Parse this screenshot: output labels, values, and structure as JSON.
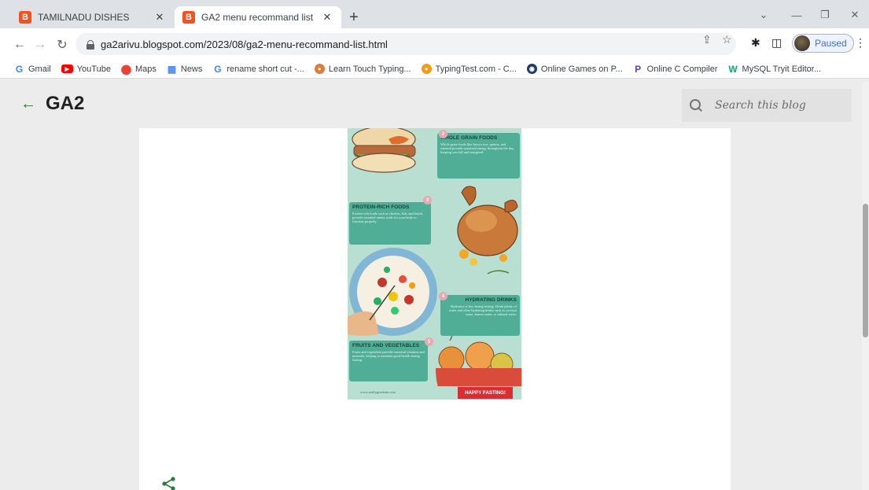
{
  "browser": {
    "tabs": [
      {
        "title": "TAMILNADU DISHES",
        "favicon": "blogger-icon",
        "active": false
      },
      {
        "title": "GA2 menu recommand list",
        "favicon": "blogger-icon",
        "active": true
      }
    ],
    "url": "ga2arivu.blogspot.com/2023/08/ga2-menu-recommand-list.html",
    "profile_status": "Paused",
    "bookmarks": [
      {
        "label": "Gmail",
        "icon": "google-icon"
      },
      {
        "label": "YouTube",
        "icon": "youtube-icon"
      },
      {
        "label": "Maps",
        "icon": "maps-icon"
      },
      {
        "label": "News",
        "icon": "news-icon"
      },
      {
        "label": "rename short cut -...",
        "icon": "google-icon"
      },
      {
        "label": "Learn Touch Typing...",
        "icon": "typing-club-icon"
      },
      {
        "label": "TypingTest.com - C...",
        "icon": "typingtest-icon"
      },
      {
        "label": "Online Games on P...",
        "icon": "poki-icon"
      },
      {
        "label": "Online C Compiler",
        "icon": "programiz-icon"
      },
      {
        "label": "MySQL Tryit Editor...",
        "icon": "w3schools-icon"
      }
    ]
  },
  "blog": {
    "title": "GA2",
    "search_placeholder": "Search this blog"
  },
  "infographic": {
    "sections": [
      {
        "number": "2",
        "title": "WHOLE GRAIN FOODS",
        "body": "Whole grain foods like brown rice, quinoa, and oatmeal provide sustained energy throughout the day, keeping you full and energized."
      },
      {
        "number": "3",
        "title": "PROTEIN-RICH FOODS",
        "body": "Protein-rich foods such as chicken, fish, and lentils provide essential amino acids for your body to function properly."
      },
      {
        "number": "4",
        "title": "HYDRATING DRINKS",
        "body": "Hydration is key during fasting. Drink plenty of water and other hydrating drinks such as coconut water, lemon water, or infused water."
      },
      {
        "number": "5",
        "title": "FRUITS AND VEGETABLES",
        "body": "Fruits and vegetables provide essential vitamins and minerals, helping to maintain good health during fasting."
      }
    ],
    "footer_url": "www.reallygreatsite.com",
    "footer_badge": "HAPPY FASTING!"
  },
  "colors": {
    "accent": "#2a7a3a",
    "panel": "#4fae95",
    "infographic_bg": "#b9dfd3",
    "badge_red": "#d92f34"
  }
}
